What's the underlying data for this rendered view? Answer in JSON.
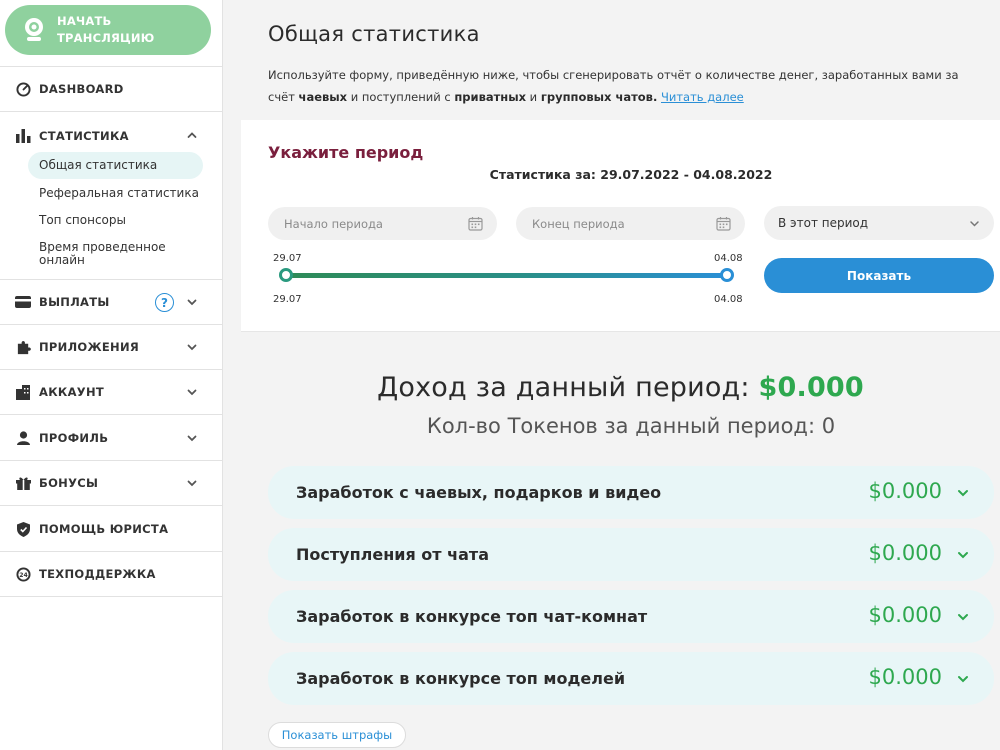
{
  "sidebar": {
    "start_button": "НАЧАТЬ ТРАНСЛЯЦИЮ",
    "dashboard": "DASHBOARD",
    "statistics": {
      "label": "СТАТИСТИКА",
      "sub": [
        "Общая статистика",
        "Реферальная статистика",
        "Топ спонсоры",
        "Время проведенное онлайн"
      ]
    },
    "payouts": "ВЫПЛАТЫ",
    "payouts_help": "?",
    "apps": "ПРИЛОЖЕНИЯ",
    "account": "АККАУНТ",
    "profile": "ПРОФИЛЬ",
    "bonuses": "БОНУСЫ",
    "legal": "ПОМОЩЬ ЮРИСТА",
    "support": "ТЕХПОДДЕРЖКА"
  },
  "page": {
    "title": "Общая статистика",
    "intro_1": "Используйте форму, приведённую ниже, чтобы сгенерировать отчёт о количестве денег, заработанных вами за счёт ",
    "intro_b1": "чаевых",
    "intro_2": " и поступлений с ",
    "intro_b2": "приватных",
    "intro_3": " и ",
    "intro_b3": "групповых чатов.",
    "intro_link": "Читать далее"
  },
  "period": {
    "title": "Укажите период",
    "range_text": "Статистика за: 29.07.2022 - 04.08.2022",
    "start_placeholder": "Начало периода",
    "end_placeholder": "Конец периода",
    "select_value": "В этот период",
    "slider_start_top": "29.07",
    "slider_end_top": "04.08",
    "slider_start_bottom": "29.07",
    "slider_end_bottom": "04.08",
    "show_button": "Показать"
  },
  "summary": {
    "income_label": "Доход за данный период: ",
    "income_value": "$0.000",
    "tokens_text": "Кол-во Токенов за данный период: 0"
  },
  "breakdown": [
    {
      "title": "Заработок с чаевых, подарков и видео",
      "value": "$0.000"
    },
    {
      "title": "Поступления от чата",
      "value": "$0.000"
    },
    {
      "title": "Заработок в конкурсе топ чат-комнат",
      "value": "$0.000"
    },
    {
      "title": "Заработок в конкурсе топ моделей",
      "value": "$0.000"
    }
  ],
  "penalties_button": "Показать штрафы",
  "colors": {
    "accent_green": "#2ea84f",
    "accent_blue": "#2a8fd6",
    "start_button": "#8fd19e",
    "period_title": "#7a1f3d"
  }
}
